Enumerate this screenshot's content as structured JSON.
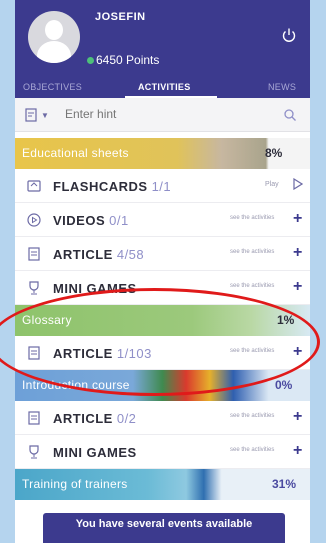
{
  "profile": {
    "name": "JOSEFIN",
    "points": "6450 Points"
  },
  "tabs": [
    {
      "label": "OBJECTIVES",
      "active": false
    },
    {
      "label": "ACTIVITIES",
      "active": true
    },
    {
      "label": "NEWS",
      "active": false
    }
  ],
  "search": {
    "placeholder": "Enter hint"
  },
  "sections": [
    {
      "title": "Educational sheets",
      "percent": "8%",
      "color": "#e8c54a"
    },
    {
      "title": "Glossary",
      "percent": "1%",
      "color": "#8ec36b"
    },
    {
      "title": "Introduction course",
      "percent": "0%",
      "color": "#6da0d8"
    },
    {
      "title": "Training of trainers",
      "percent": "31%",
      "color": "#4ba6c9"
    }
  ],
  "rows": [
    {
      "title": "FLASHCARDS",
      "count": "1/1",
      "action": "Play",
      "icon": "flashcard-icon"
    },
    {
      "title": "VIDEOS",
      "count": "0/1",
      "action": "see the activities",
      "icon": "play-circle-icon"
    },
    {
      "title": "ARTICLE",
      "count": "4/58",
      "action": "see the activities",
      "icon": "document-icon"
    },
    {
      "title": "MINI GAMES",
      "count": "",
      "action": "see the activities",
      "icon": "trophy-icon"
    },
    {
      "title": "ARTICLE",
      "count": "1/103",
      "action": "see the activities",
      "icon": "document-icon"
    },
    {
      "title": "ARTICLE",
      "count": "0/2",
      "action": "see the activities",
      "icon": "document-icon"
    },
    {
      "title": "MINI GAMES",
      "count": "",
      "action": "see the activities",
      "icon": "trophy-icon"
    }
  ],
  "cta": {
    "label": "You have several events available"
  },
  "colors": {
    "header": "#3c3a8e",
    "accent": "#3c3a8e",
    "highlight": "#e01a1a"
  }
}
